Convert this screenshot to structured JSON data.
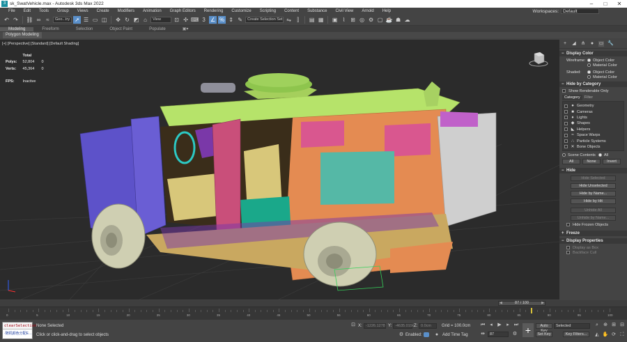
{
  "window": {
    "title": "sk_SwatVehicle.max - Autodesk 3ds Max 2022",
    "app_icon": "3"
  },
  "menu": [
    "File",
    "Edit",
    "Tools",
    "Group",
    "Views",
    "Create",
    "Modifiers",
    "Animation",
    "Graph Editors",
    "Rendering",
    "Customize",
    "Scripting",
    "Content",
    "Substance",
    "Civil View",
    "Arnold",
    "Help"
  ],
  "workspaces": {
    "label": "Workspaces:",
    "value": "Default"
  },
  "toolbar": {
    "selection_filter": "Geo...try",
    "ref_coord": "View",
    "named_selection": "Create Selection Set",
    "snap_angle": "3"
  },
  "ribbon": {
    "tabs": [
      "Modeling",
      "Freeform",
      "Selection",
      "Object Paint",
      "Populate"
    ],
    "active_tab": "Modeling",
    "panel": "Polygon Modeling"
  },
  "viewport": {
    "label": "[+] [Perspective] [Standard] [Default Shading]",
    "stats": {
      "header": "Total",
      "polys_label": "Polys:",
      "polys_total": "52,804",
      "polys_sel": "0",
      "verts_label": "Verts:",
      "verts_total": "45,364",
      "verts_sel": "0",
      "fps_label": "FPS:",
      "fps_value": "Inactive"
    }
  },
  "panel": {
    "display_color": {
      "title": "Display Color",
      "wireframe_label": "Wireframe:",
      "shaded_label": "Shaded:",
      "object_color": "Object Color",
      "material_color": "Material Color"
    },
    "hide_by_category": {
      "title": "Hide by Category",
      "show_renderable": "Show Renderable Only",
      "tab_category": "Category",
      "tab_filter": "Filter",
      "items": [
        "Geometry",
        "Cameras",
        "Lights",
        "Shapes",
        "Helpers",
        "Space Warps",
        "Particle Systems",
        "Bone Objects"
      ],
      "scene_contents": "Scene Contents",
      "all_radio": "All",
      "btn_all": "All",
      "btn_none": "None",
      "btn_invert": "Invert"
    },
    "hide": {
      "title": "Hide",
      "hide_selected": "Hide Selected",
      "hide_unselected": "Hide Unselected",
      "hide_by_name": "Hide by Name...",
      "hide_by_hit": "Hide by Hit",
      "unhide_all": "Unhide All",
      "unhide_by_name": "Unhide by Name...",
      "hide_frozen": "Hide Frozen Objects"
    },
    "freeze": {
      "title": "Freeze"
    },
    "display_properties": {
      "title": "Display Properties",
      "display_as_box": "Display as Box",
      "backface_cull": "Backface Cull"
    }
  },
  "timeline": {
    "frame": "87 / 100",
    "ticks": [
      "0",
      "5",
      "10",
      "15",
      "20",
      "25",
      "30",
      "35",
      "40",
      "45",
      "50",
      "55",
      "60",
      "65",
      "70",
      "75",
      "80",
      "85",
      "90",
      "95",
      "100"
    ]
  },
  "status": {
    "maxscript_line1": "clearSelection",
    "maxscript_line2": "·随机颜色分配E…",
    "selection": "None Selected",
    "prompt": "Click or click-and-drag to select objects",
    "x_label": "X:",
    "x_value": "-1226.1278",
    "y_label": "Y:",
    "y_value": "-4635.019c",
    "z_label": "Z:",
    "z_value": "0.0cm",
    "grid": "Grid = 100.0cm",
    "enabled": "Enabled:",
    "add_time_tag": "Add Time Tag",
    "auto_key": "Auto Key",
    "set_key": "Set Key",
    "key_mode": "Selected",
    "key_filters": "Key Filters...",
    "frame_field": "87"
  },
  "colors": {
    "accent": "#5a8fc9",
    "viewport_bg": "#2b2b2b",
    "panel_bg": "#444444",
    "body_green": "#b6e36a",
    "body_orange": "#e48b52",
    "door_purple": "#5d52c9",
    "door_pink": "#c94f7a",
    "tire": "#cfcfb2"
  }
}
